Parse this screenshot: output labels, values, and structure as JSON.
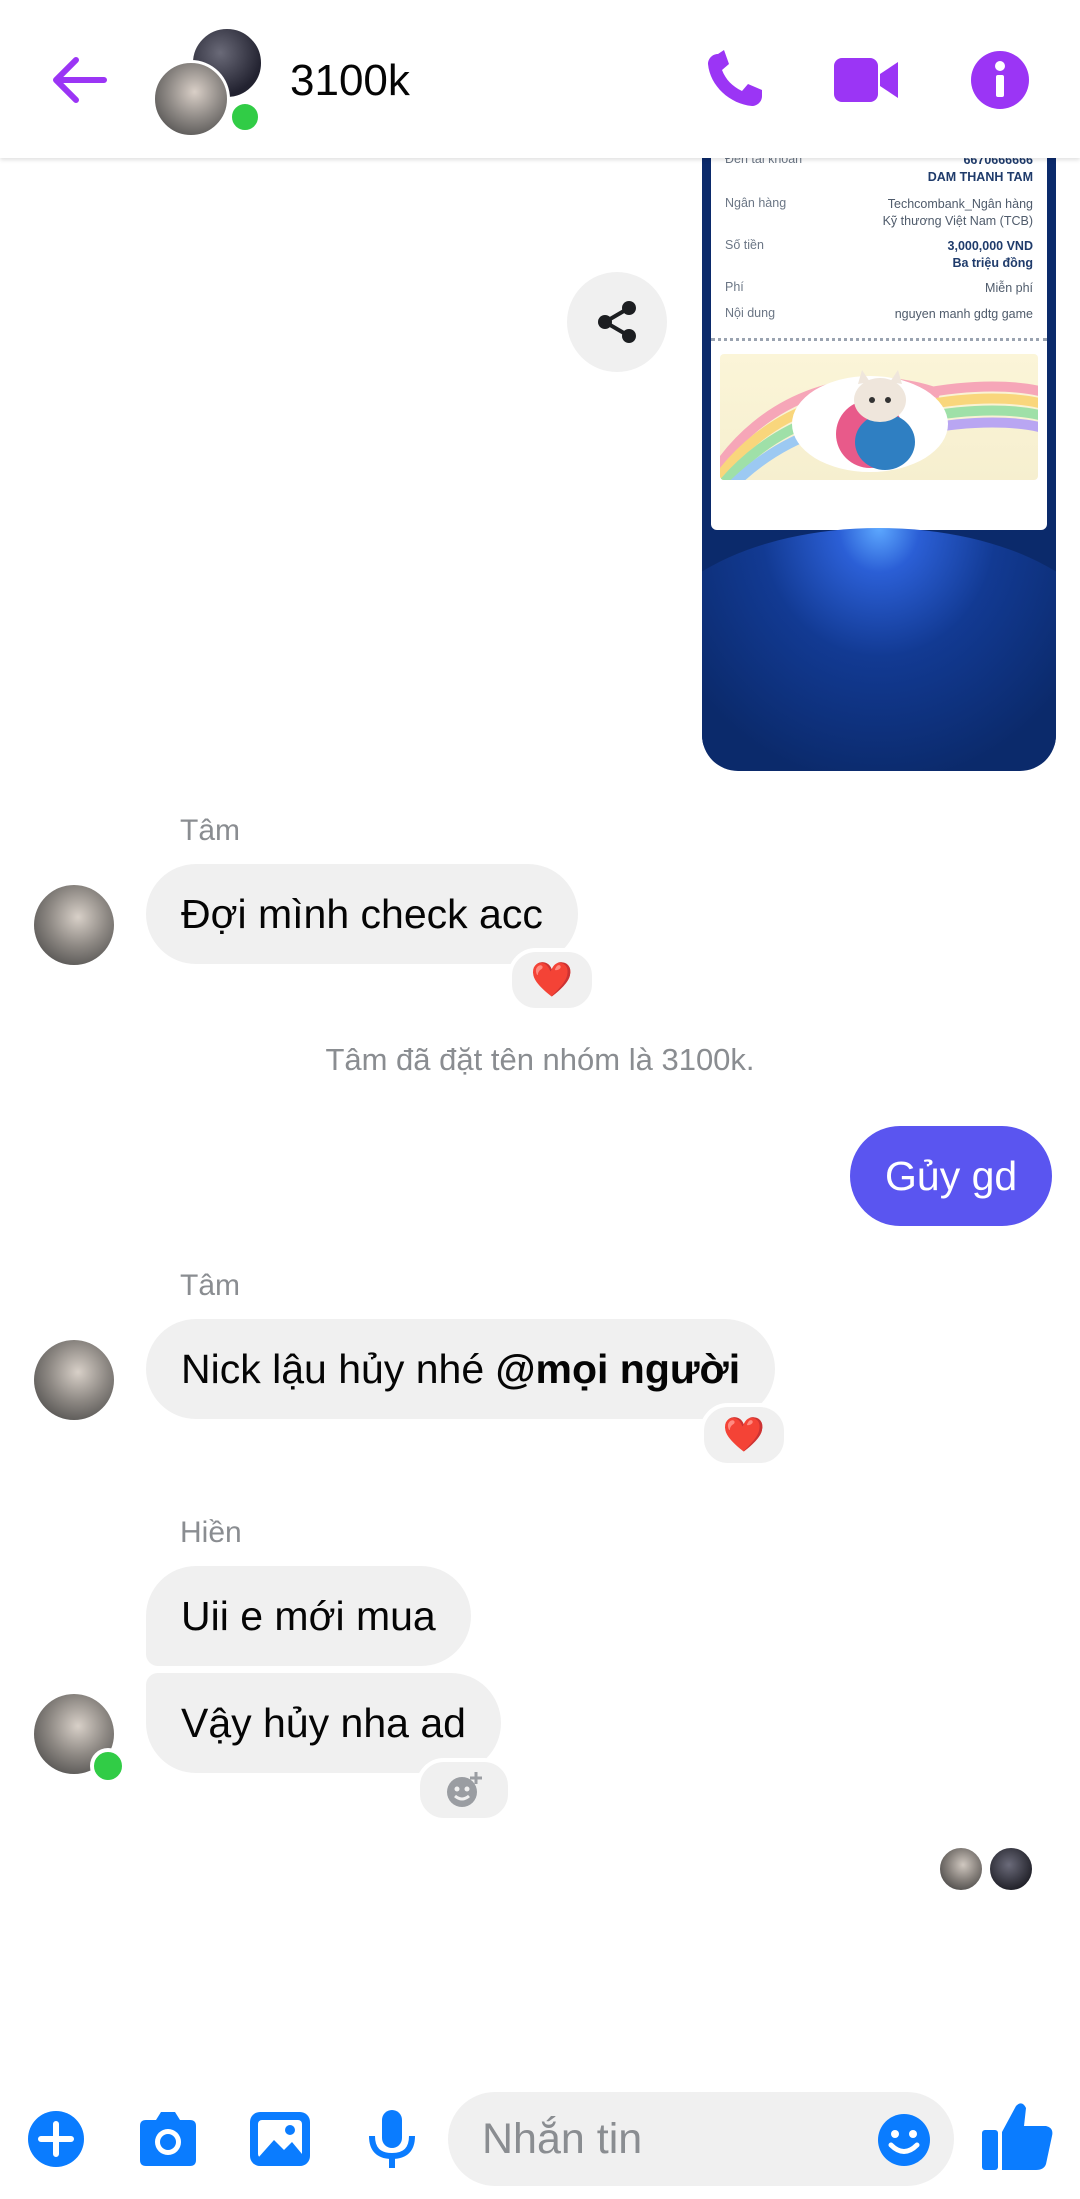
{
  "header": {
    "title": "3100k",
    "accent": "#9b35f5"
  },
  "shared_image": {
    "receipt": {
      "to_account_label": "Đến tài khoản",
      "to_account_number": "6670666666",
      "to_account_name": "DAM THANH TAM",
      "bank_label": "Ngân hàng",
      "bank_line1": "Techcombank_Ngân hàng",
      "bank_line2": "Kỹ thương Việt Nam (TCB)",
      "amount_label": "Số tiền",
      "amount_value": "3,000,000 VND",
      "amount_words": "Ba triệu đồng",
      "fee_label": "Phí",
      "fee_value": "Miễn phí",
      "content_label": "Nội dung",
      "content_value": "nguyen manh gdtg game"
    }
  },
  "messages": {
    "m1": {
      "sender": "Tâm",
      "text": "Đợi mình check acc",
      "reaction": "❤️"
    },
    "system": "Tâm đã đặt tên nhóm là 3100k.",
    "m2": {
      "text": "Gủy gd"
    },
    "m3": {
      "sender": "Tâm",
      "text": "Nick lậu hủy nhé ",
      "mention": "@mọi người",
      "reaction": "❤️"
    },
    "m4": {
      "sender": "Hiền",
      "text1": "Uii e mới mua",
      "text2": "Vậy hủy nha ad"
    }
  },
  "composer": {
    "placeholder": "Nhắn tin",
    "icon_color": "#0a7cff"
  },
  "colors": {
    "outgoing_bubble": "#5a55f0",
    "incoming_bubble": "#f0f0f0",
    "online": "#31cc46"
  }
}
